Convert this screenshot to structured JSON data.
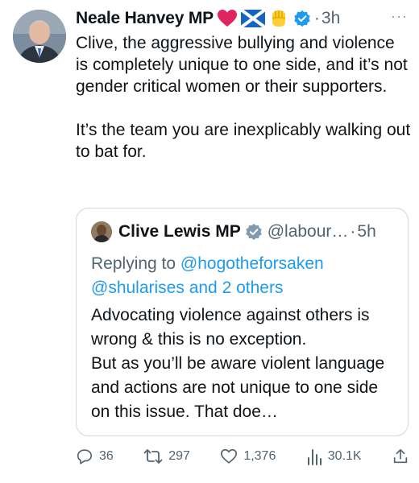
{
  "tweet": {
    "author_name": "Neale Hanvey MP",
    "emojis": [
      "heart-emoji",
      "scotland-flag-emoji",
      "raised-fist-emoji"
    ],
    "separator": "·",
    "time": "3h",
    "more": "···",
    "text": "Clive, the aggressive bullying and violence is completely unique to one side, and it’s not gender critical women or their supporters.\n\nIt’s the team you are inexplicably walking out to bat for."
  },
  "quote": {
    "author_name": "Clive Lewis MP",
    "handle": "@labour…",
    "separator": "·",
    "time": "5h",
    "replying_to_label": "Replying to",
    "replying_to_user": "@hogotheforsaken",
    "replying_to_others": "@shularises and 2 others",
    "text": "Advocating violence against others is wrong & this is no exception.\nBut as you’ll be aware violent language and actions are not unique to one side on this issue. That doe…"
  },
  "actions": {
    "replies": "36",
    "retweets": "297",
    "likes": "1,376",
    "views": "30.1K"
  },
  "colors": {
    "text": "#0f1419",
    "secondary": "#536471",
    "link": "#1d9bf0",
    "verified": "#1d9bf0",
    "border": "#cfd9de"
  },
  "icons": [
    "verified-icon",
    "reply-icon",
    "retweet-icon",
    "like-icon",
    "views-icon",
    "share-icon",
    "more-icon"
  ]
}
